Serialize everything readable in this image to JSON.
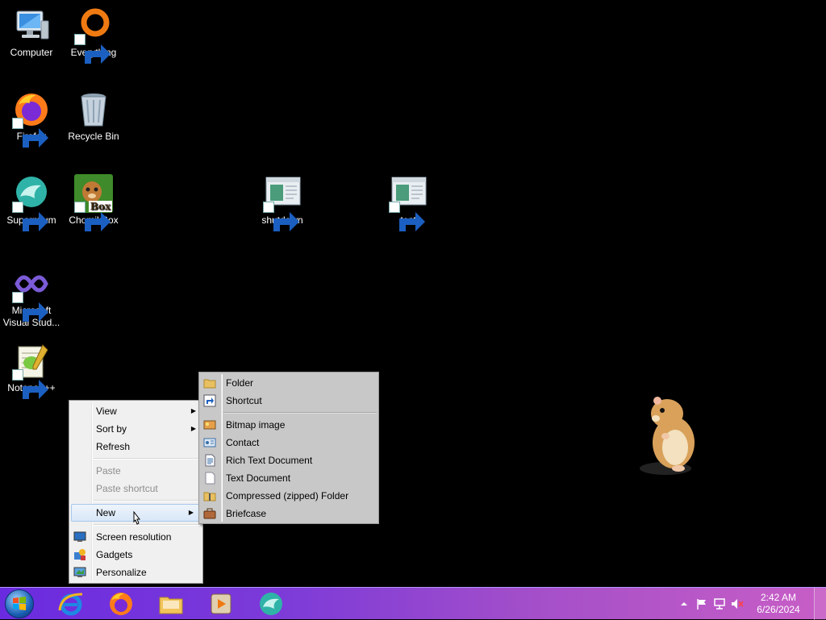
{
  "desktop": {
    "icons": [
      {
        "label": "Computer"
      },
      {
        "label": "Everything"
      },
      {
        "label": "Firefox"
      },
      {
        "label": "Recycle Bin"
      },
      {
        "label": "Supermium"
      },
      {
        "label": "ChomikBox"
      },
      {
        "label": "shutdown"
      },
      {
        "label": "test"
      },
      {
        "label": "Microsoft Visual Stud..."
      },
      {
        "label": "Notepad++"
      }
    ],
    "chomikbox_badge": "Box"
  },
  "context_menu": {
    "items": [
      {
        "label": "View",
        "arrow": "▶"
      },
      {
        "label": "Sort by",
        "arrow": "▶"
      },
      {
        "label": "Refresh"
      },
      {
        "label": "Paste"
      },
      {
        "label": "Paste shortcut"
      },
      {
        "label": "New",
        "arrow": "▶"
      },
      {
        "label": "Screen resolution"
      },
      {
        "label": "Gadgets"
      },
      {
        "label": "Personalize"
      }
    ]
  },
  "new_menu": {
    "items": [
      {
        "label": "Folder"
      },
      {
        "label": "Shortcut"
      },
      {
        "label": "Bitmap image"
      },
      {
        "label": "Contact"
      },
      {
        "label": "Rich Text Document"
      },
      {
        "label": "Text Document"
      },
      {
        "label": "Compressed (zipped) Folder"
      },
      {
        "label": "Briefcase"
      }
    ]
  },
  "taskbar": {
    "pinned": [
      "internet-explorer-icon",
      "firefox-icon",
      "file-explorer-icon",
      "media-player-icon",
      "supermium-icon"
    ],
    "clock": {
      "time": "2:42 AM",
      "date": "6/26/2024"
    },
    "tray_icons": [
      "show-hidden-icons-arrow",
      "action-center-flag-icon",
      "network-icon",
      "volume-muted-icon"
    ]
  },
  "colors": {
    "menu_bg": "#f0f0f0",
    "new_menu_bg": "#c8c8c8",
    "menu_highlight": "#d8e7f8",
    "taskbar_start": "#6a2be0",
    "taskbar_end": "#c85ec6",
    "desktop_bg": "#000000"
  }
}
